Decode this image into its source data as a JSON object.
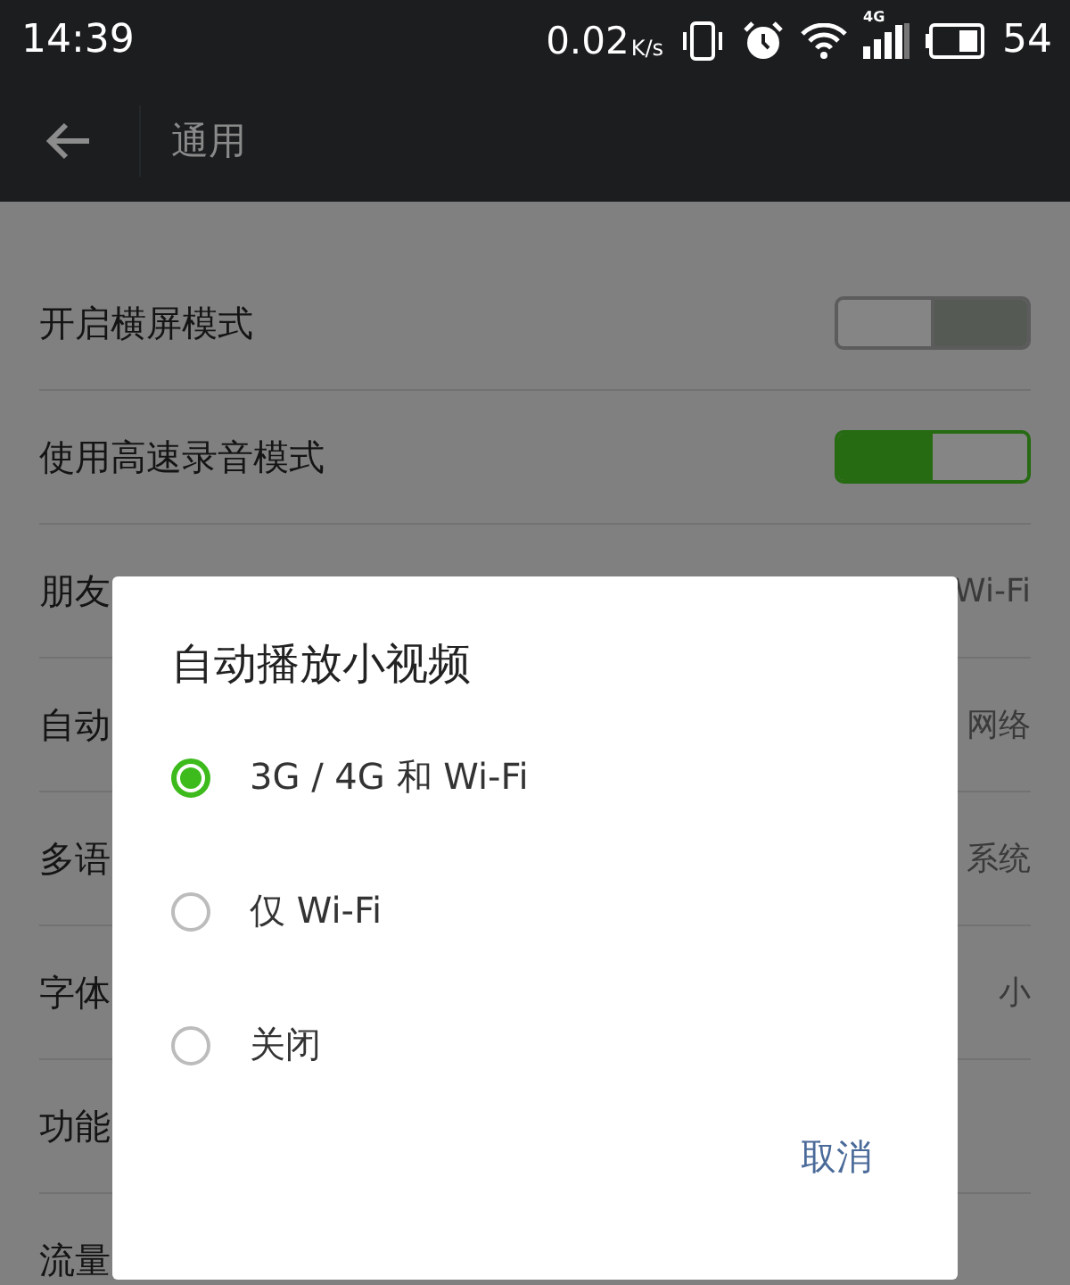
{
  "status_bar": {
    "time": "14:39",
    "speed": "0.02",
    "speed_unit": "K/s",
    "network": "4G",
    "battery": "54"
  },
  "app_bar": {
    "title": "通用"
  },
  "settings": [
    {
      "kind": "toggle",
      "label": "开启横屏模式",
      "on": false
    },
    {
      "kind": "toggle",
      "label": "使用高速录音模式",
      "on": true
    },
    {
      "kind": "value",
      "label": "朋友",
      "value": "Wi-Fi"
    },
    {
      "kind": "value",
      "label": "自动",
      "value": "网络"
    },
    {
      "kind": "value",
      "label": "多语",
      "value": "系统"
    },
    {
      "kind": "value",
      "label": "字体",
      "value": "小"
    },
    {
      "kind": "value",
      "label": "功能"
    },
    {
      "kind": "value",
      "label": "流量"
    }
  ],
  "dialog": {
    "title": "自动播放小视频",
    "options": [
      {
        "label": "3G / 4G 和 Wi-Fi",
        "selected": true
      },
      {
        "label": "仅 Wi-Fi",
        "selected": false
      },
      {
        "label": "关闭",
        "selected": false
      }
    ],
    "cancel": "取消"
  }
}
